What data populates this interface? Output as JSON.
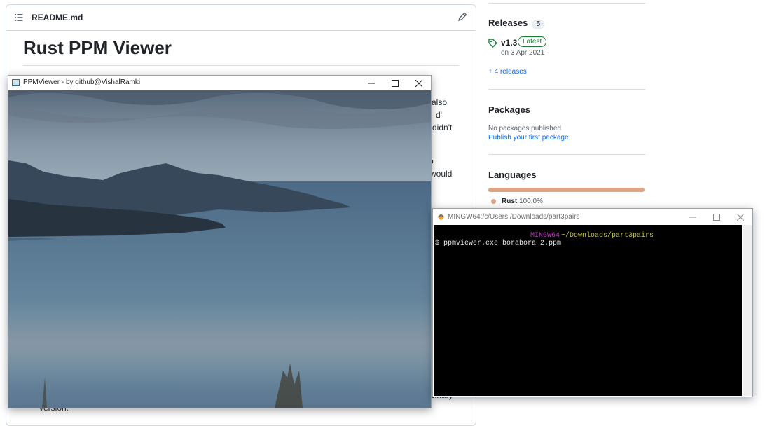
{
  "readme": {
    "filename": "README.md",
    "title": "Rust PPM Viewer",
    "fragments": [
      "ve also",
      "d'",
      "didn't",
      "o",
      "would",
      "binary",
      "version."
    ]
  },
  "sidebar": {
    "releases": {
      "heading": "Releases",
      "count": "5",
      "latest_version": "v1.3",
      "latest_badge": "Latest",
      "date": "on 3 Apr 2021",
      "more_link": "+ 4 releases"
    },
    "packages": {
      "heading": "Packages",
      "empty_text": "No packages published",
      "publish_link": "Publish your first package"
    },
    "languages": {
      "heading": "Languages",
      "items": [
        {
          "name": "Rust",
          "percent": "100.0%",
          "color": "#dea584",
          "share": 1.0
        }
      ]
    }
  },
  "viewer_window": {
    "title": "PPMViewer - by github@VishalRamki",
    "minimize": "—",
    "maximize": "☐",
    "close": "✕"
  },
  "terminal_window": {
    "title": "MINGW64:/c/Users /Downloads/part3pairs",
    "prompt_system": "MINGW64",
    "prompt_path": "~/Downloads/part3pairs",
    "command_line": "$ ppmviewer.exe borabora_2.ppm",
    "colors": {
      "system": "#c23bc6",
      "path": "#c8c83a",
      "text": "#e6e6e6"
    }
  }
}
